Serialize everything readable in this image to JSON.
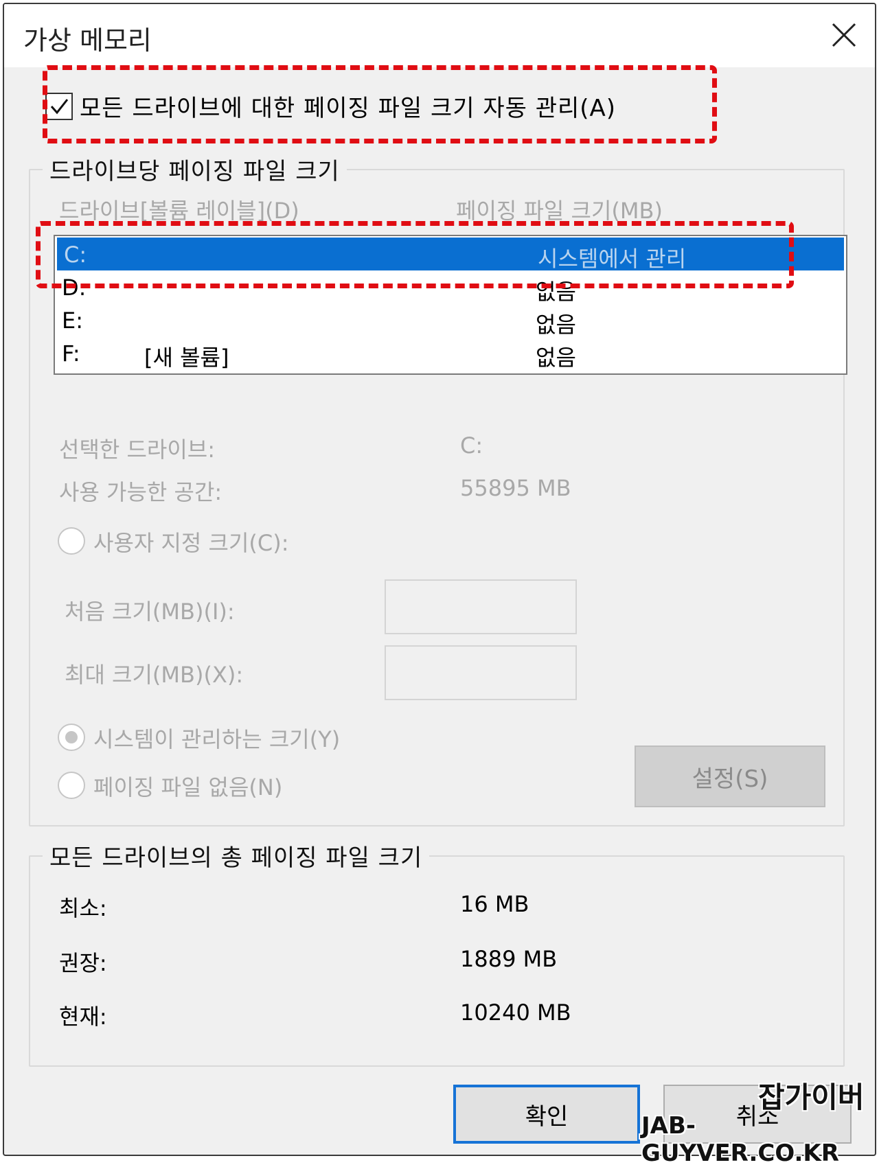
{
  "window": {
    "title": "가상 메모리"
  },
  "auto_manage": {
    "label": "모든 드라이브에 대한 페이징 파일 크기 자동 관리(A)",
    "checked": true
  },
  "per_drive": {
    "legend": "드라이브당 페이징 파일 크기",
    "col_drive": "드라이브[볼륨 레이블](D)",
    "col_size": "페이징 파일 크기(MB)",
    "rows": [
      {
        "drive": "C:",
        "volume": "",
        "size": "시스템에서 관리",
        "selected": true
      },
      {
        "drive": "D:",
        "volume": "",
        "size": "없음",
        "selected": false
      },
      {
        "drive": "E:",
        "volume": "",
        "size": "없음",
        "selected": false
      },
      {
        "drive": "F:",
        "volume": "[새 볼륨]",
        "size": "없음",
        "selected": false
      }
    ],
    "selected_drive_label": "선택한 드라이브:",
    "selected_drive_value": "C:",
    "free_space_label": "사용 가능한 공간:",
    "free_space_value": "55895 MB",
    "custom_size_label": "사용자 지정 크기(C):",
    "initial_size_label": "처음 크기(MB)(I):",
    "max_size_label": "최대 크기(MB)(X):",
    "system_managed_label": "시스템이 관리하는 크기(Y)",
    "no_paging_label": "페이징 파일 없음(N)",
    "set_button": "설정(S)"
  },
  "totals": {
    "legend": "모든 드라이브의 총 페이징 파일 크기",
    "min_label": "최소:",
    "min_value": "16 MB",
    "rec_label": "권장:",
    "rec_value": "1889 MB",
    "cur_label": "현재:",
    "cur_value": "10240 MB"
  },
  "buttons": {
    "ok": "확인",
    "cancel": "취소"
  },
  "watermark": {
    "line1": "잡가이버",
    "line2": "JAB-GUYVER.CO.KR"
  },
  "colors": {
    "highlight": "#e00d13",
    "selection": "#0a6fd1",
    "ok_border": "#1673d6"
  }
}
